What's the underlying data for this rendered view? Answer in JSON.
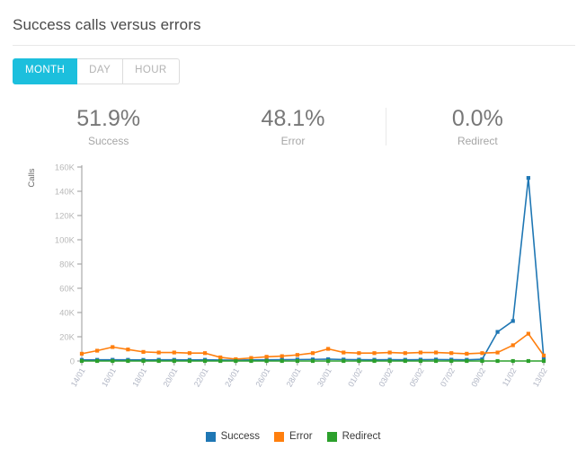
{
  "header": {
    "title": "Success calls versus errors"
  },
  "toolbar": {
    "buttons": [
      {
        "label": "MONTH",
        "active": true
      },
      {
        "label": "DAY",
        "active": false
      },
      {
        "label": "HOUR",
        "active": false
      }
    ]
  },
  "stats": [
    {
      "value": "51.9%",
      "label": "Success"
    },
    {
      "value": "48.1%",
      "label": "Error"
    },
    {
      "value": "0.0%",
      "label": "Redirect"
    }
  ],
  "legend": [
    {
      "label": "Success",
      "color": "#1f77b4"
    },
    {
      "label": "Error",
      "color": "#ff7f0e"
    },
    {
      "label": "Redirect",
      "color": "#2ca02c"
    }
  ],
  "chart_data": {
    "type": "line",
    "title": "",
    "xlabel": "",
    "ylabel": "Calls",
    "ylim": [
      0,
      160000
    ],
    "yticks": [
      0,
      20000,
      40000,
      60000,
      80000,
      100000,
      120000,
      140000,
      160000
    ],
    "ytick_labels": [
      "0",
      "20K",
      "40K",
      "60K",
      "80K",
      "100K",
      "120K",
      "140K",
      "160K"
    ],
    "grid": false,
    "legend_position": "bottom",
    "categories": [
      "14/01",
      "15/01",
      "16/01",
      "17/01",
      "18/01",
      "19/01",
      "20/01",
      "21/01",
      "22/01",
      "23/01",
      "24/01",
      "25/01",
      "26/01",
      "27/01",
      "28/01",
      "29/01",
      "30/01",
      "31/01",
      "01/02",
      "02/02",
      "03/02",
      "04/02",
      "05/02",
      "06/02",
      "07/02",
      "08/02",
      "09/02",
      "10/02",
      "11/02",
      "12/02",
      "13/02"
    ],
    "xtick_labels": [
      "14/01",
      "16/01",
      "18/01",
      "20/01",
      "22/01",
      "24/01",
      "26/01",
      "28/01",
      "30/01",
      "01/02",
      "03/02",
      "05/02",
      "07/02",
      "09/02",
      "11/02",
      "13/02"
    ],
    "xtick_indices": [
      0,
      2,
      4,
      6,
      8,
      10,
      12,
      14,
      16,
      18,
      20,
      22,
      24,
      26,
      28,
      30
    ],
    "series": [
      {
        "name": "Success",
        "color": "#1f77b4",
        "values": [
          900,
          950,
          1000,
          950,
          900,
          1000,
          950,
          900,
          1000,
          800,
          700,
          900,
          1000,
          1100,
          1200,
          1300,
          1500,
          1200,
          1100,
          1000,
          1100,
          1000,
          1100,
          1200,
          1100,
          1000,
          1400,
          24000,
          33000,
          151000,
          2000
        ]
      },
      {
        "name": "Error",
        "color": "#ff7f0e",
        "values": [
          6000,
          8500,
          11500,
          9500,
          7500,
          7000,
          7000,
          6500,
          6500,
          3000,
          1500,
          2500,
          3500,
          4000,
          5000,
          6500,
          10000,
          7000,
          6500,
          6500,
          7000,
          6500,
          7000,
          7000,
          6500,
          6000,
          6500,
          7000,
          13000,
          22500,
          4500
        ]
      },
      {
        "name": "Redirect",
        "color": "#2ca02c",
        "values": [
          0,
          0,
          0,
          0,
          0,
          0,
          0,
          0,
          0,
          0,
          0,
          0,
          0,
          0,
          0,
          0,
          0,
          0,
          0,
          0,
          0,
          0,
          0,
          0,
          0,
          0,
          0,
          0,
          0,
          0,
          0
        ]
      }
    ]
  }
}
